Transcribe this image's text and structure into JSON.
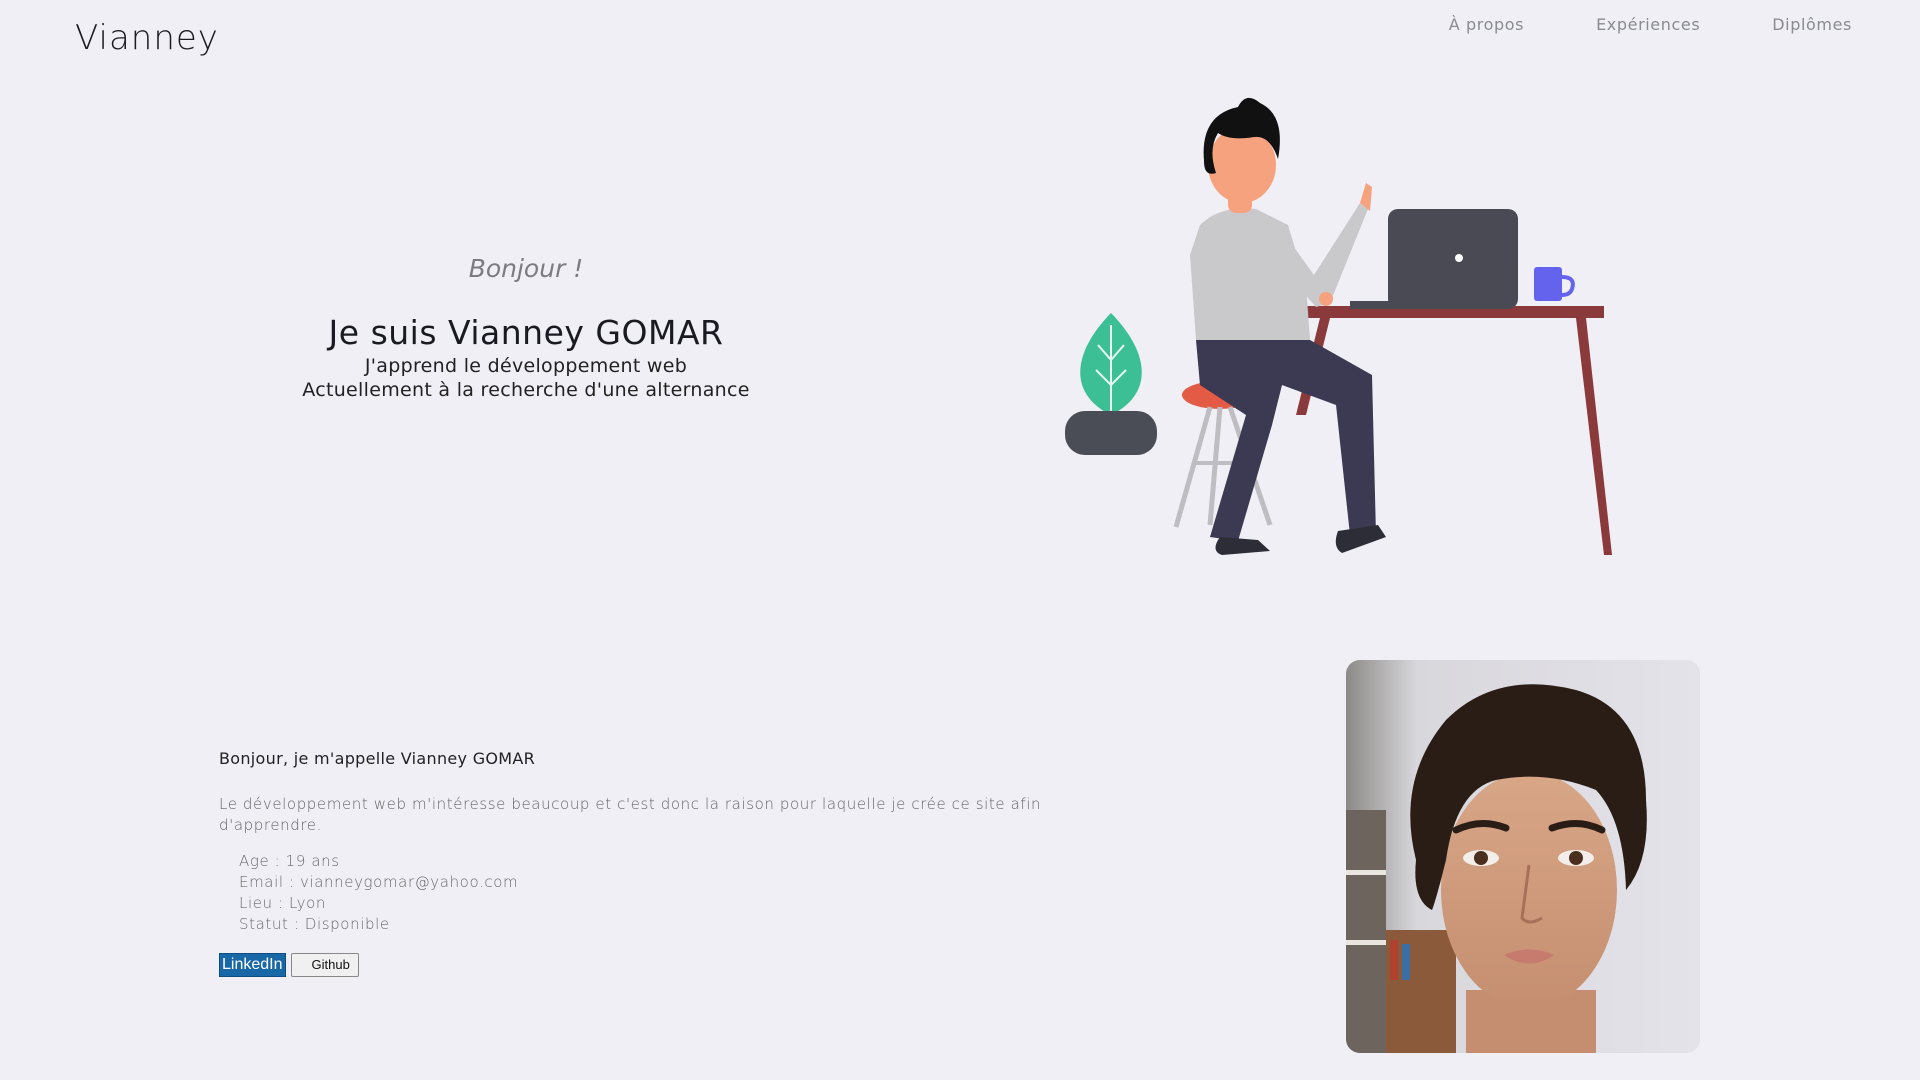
{
  "header": {
    "brand": "Vianney",
    "nav": [
      "À propos",
      "Expériences",
      "Diplômes"
    ]
  },
  "hero": {
    "greeting": "Bonjour !",
    "title": "Je suis Vianney GOMAR",
    "subtitle_1": "J'apprend le développement web",
    "subtitle_2": "Actuellement à la recherche d'une alternance"
  },
  "about": {
    "heading": "Bonjour, je m'appelle Vianney GOMAR",
    "description": "Le développement web m'intéresse beaucoup et c'est donc la raison pour laquelle je crée ce site afin d'apprendre.",
    "details": [
      "Age : 19 ans",
      "Email : vianneygomar@yahoo.com",
      "Lieu : Lyon",
      "Statut : Disponible"
    ],
    "linkedin_label": "LinkedIn",
    "github_label": "Github"
  },
  "icons": {
    "illustration": "developer-at-desk-illustration",
    "portrait": "profile-photo"
  },
  "colors": {
    "background": "#efeff5",
    "linkedin": "#1868a8",
    "desk": "#8b3a3c",
    "laptop": "#4a4a55",
    "plant": "#3dbf95",
    "mug": "#6463ee"
  }
}
